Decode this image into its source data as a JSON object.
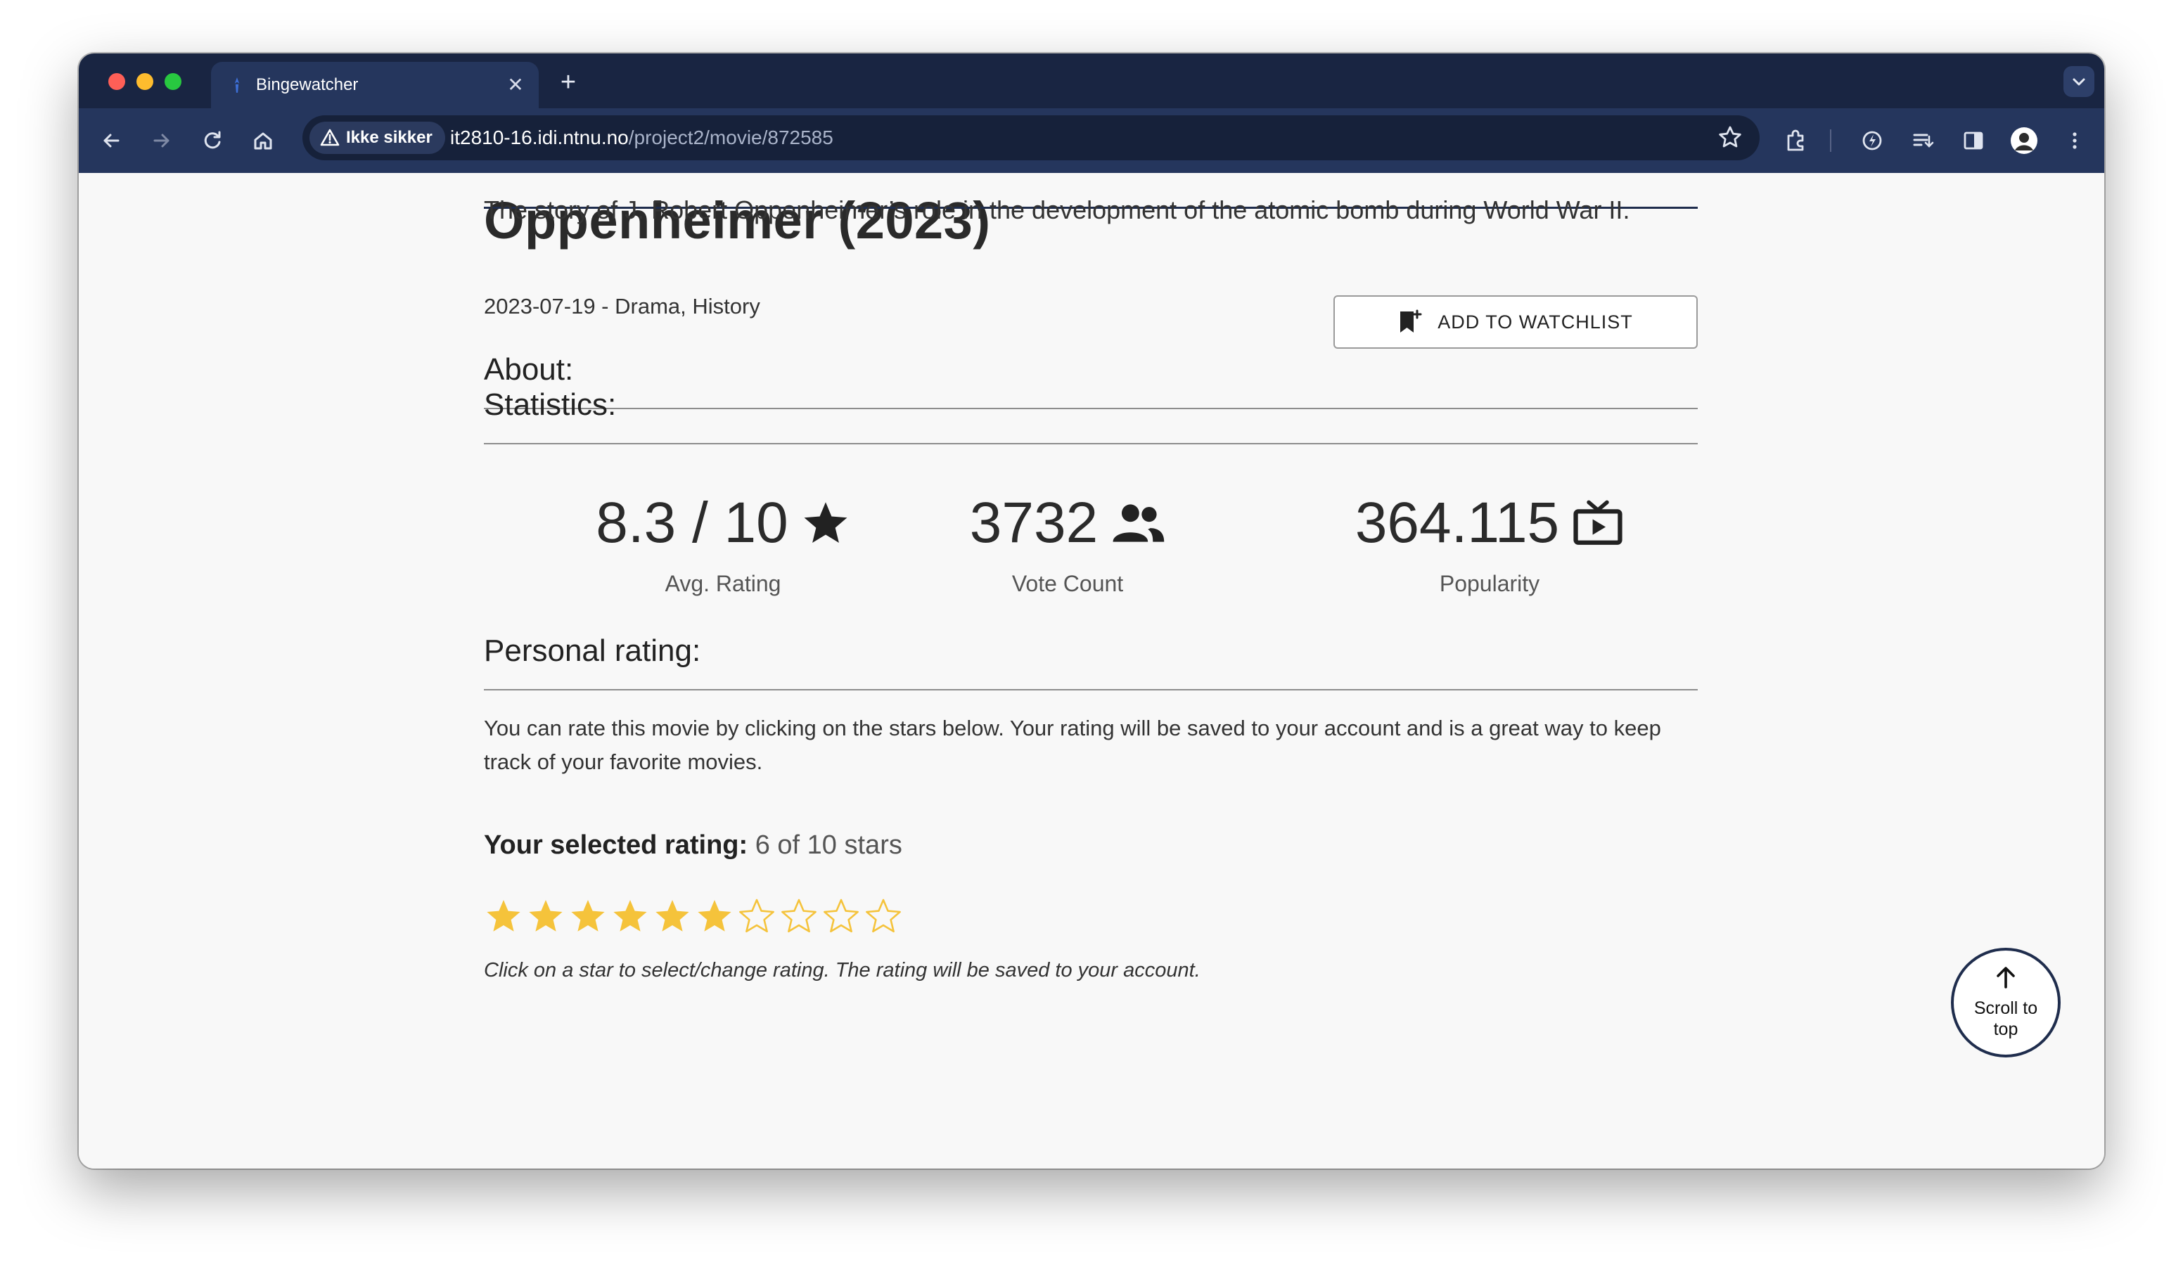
{
  "browser": {
    "tab_title": "Bingewatcher",
    "security_label": "Ikke sikker",
    "url_host": "it2810-16.idi.ntnu.no",
    "url_path": "/project2/movie/872585",
    "icons": [
      "back-icon",
      "forward-icon",
      "reload-icon",
      "home-icon",
      "warning-icon",
      "bookmark-star-icon",
      "extensions-icon",
      "performance-icon",
      "reading-list-icon",
      "side-panel-icon",
      "profile-avatar",
      "more-menu-icon"
    ]
  },
  "movie": {
    "title": "Oppenheimer (2023)",
    "meta": "2023-07-19 - Drama, History",
    "watchlist_label": "ADD TO WATCHLIST",
    "about_heading": "About:",
    "about_text": "The story of J. Robert Oppenheimer’s role in the development of the atomic bomb during World War II.",
    "statistics_heading": "Statistics:",
    "stats": [
      {
        "value": "8.3 / 10",
        "label": "Avg. Rating",
        "icon": "star-icon"
      },
      {
        "value": "3732",
        "label": "Vote Count",
        "icon": "people-icon"
      },
      {
        "value": "364.115",
        "label": "Popularity",
        "icon": "tv-icon"
      }
    ],
    "personal_heading": "Personal rating:",
    "personal_text": "You can rate this movie by clicking on the stars below. Your rating will be saved to your account and is a great way to keep track of your favorite movies.",
    "selected_rating_label": "Your selected rating:",
    "selected_rating_value": "6 of 10 stars",
    "rating": {
      "selected": 6,
      "max": 10
    },
    "hint": "Click on a star to select/change rating. The rating will be saved to your account.",
    "scroll_top_label": "Scroll to top"
  },
  "colors": {
    "browser_frame": "#192542",
    "toolbar": "#25365d",
    "accent_navy": "#1f2d4d",
    "star_filled": "#f5c33b",
    "page_bg": "#f8f8f8"
  }
}
